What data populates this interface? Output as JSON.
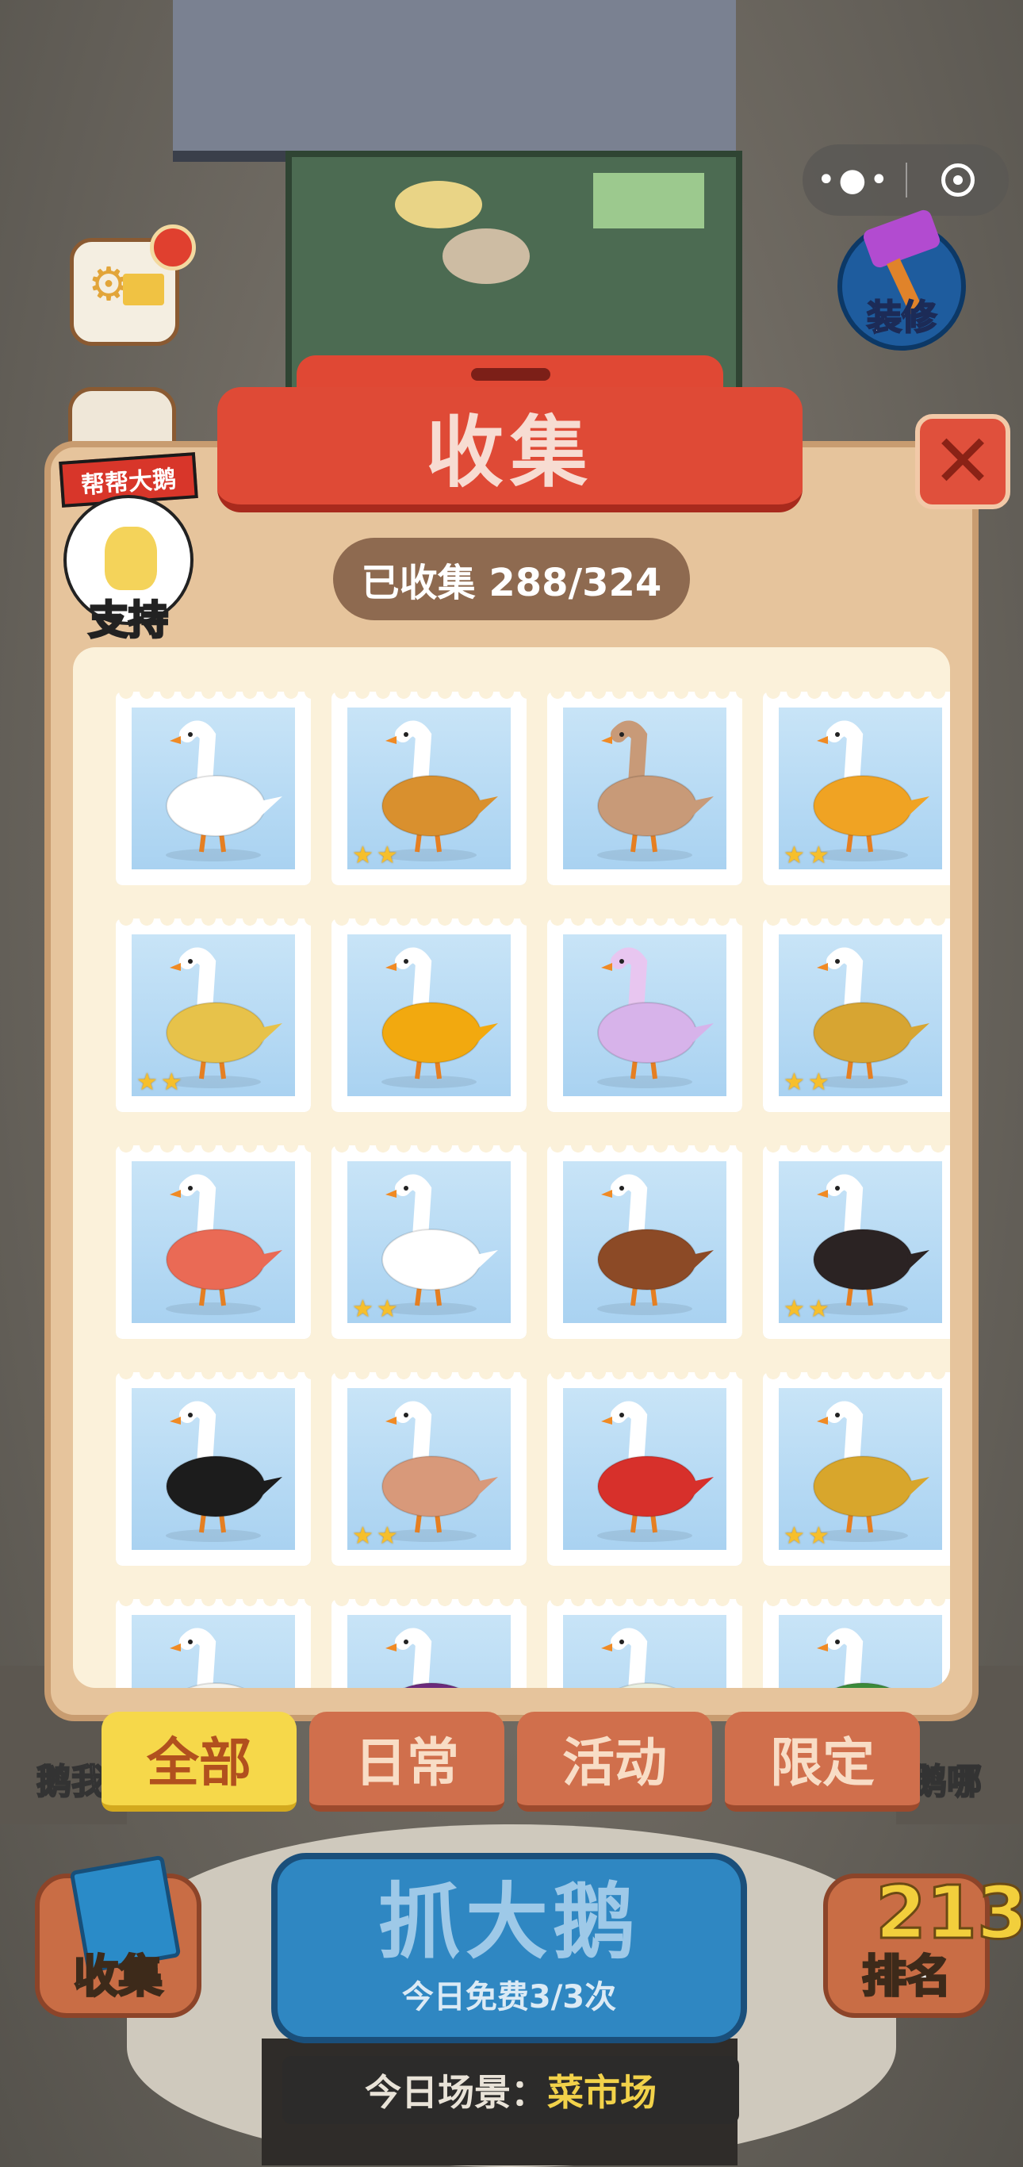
{
  "topbar": {
    "more_glyph": "•●•"
  },
  "scene_buttons": {
    "renovate_label": "装修"
  },
  "panel": {
    "title": "收集",
    "close_glyph": "✕",
    "support": {
      "badge": "帮帮大鹅",
      "label": "支持"
    },
    "collected_text": "已收集 288/324",
    "stamps": [
      {
        "item": "white-goose",
        "stars": 0
      },
      {
        "item": "pancake-goose",
        "stars": 2
      },
      {
        "item": "knit-goose",
        "stars": 0
      },
      {
        "item": "pumpkin-goose",
        "stars": 2
      },
      {
        "item": "jar-goose",
        "stars": 2
      },
      {
        "item": "mango-goose",
        "stars": 0
      },
      {
        "item": "crystal-goose",
        "stars": 0
      },
      {
        "item": "chocolate-box-goose",
        "stars": 2
      },
      {
        "item": "peach-goose",
        "stars": 0
      },
      {
        "item": "necklace-goose",
        "stars": 2
      },
      {
        "item": "wooden-bowl-goose",
        "stars": 0
      },
      {
        "item": "half-black-goose",
        "stars": 2
      },
      {
        "item": "eight-ball-goose",
        "stars": 0
      },
      {
        "item": "goose-tin-goose",
        "stars": 2
      },
      {
        "item": "mailbox-goose",
        "stars": 0
      },
      {
        "item": "golden-eggplant-goose",
        "stars": 2
      },
      {
        "item": "tofu-goose",
        "stars": 0
      },
      {
        "item": "cabbage-goose",
        "stars": 0
      },
      {
        "item": "mahjong-goose",
        "stars": 0
      },
      {
        "item": "watermelon-goose",
        "stars": 0
      }
    ],
    "star_glyph": "★"
  },
  "tabs": [
    {
      "label": "全部",
      "active": true
    },
    {
      "label": "日常",
      "active": false
    },
    {
      "label": "活动",
      "active": false
    },
    {
      "label": "限定",
      "active": false
    }
  ],
  "edge_labels": {
    "left": "鹅我",
    "right": "鹅哪"
  },
  "bottom": {
    "collection_label": "收集",
    "catch_main": "抓大鹅",
    "catch_sub": "今日免费3/3次",
    "rank_label": "排名",
    "rank_glyph": "213",
    "scene_key": "今日场景：",
    "scene_value": "菜市场"
  },
  "colors": {
    "panel": "#e6c49c",
    "banner": "#df4a36",
    "tab_active": "#f6d84a",
    "tab_inactive": "#d06f4c",
    "catch_button": "#2f87c2",
    "star": "#f6bf2c"
  }
}
